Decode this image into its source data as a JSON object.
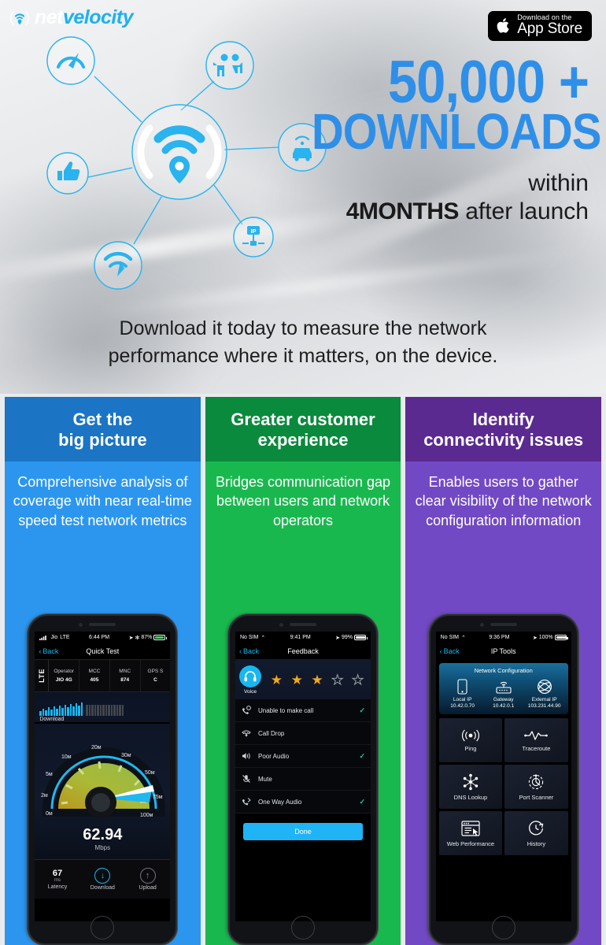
{
  "brand": {
    "name_part1": "net",
    "name_part2": "velocity",
    "accent": "#1eb0f0"
  },
  "appstore": {
    "small": "Download on the",
    "big": "App Store",
    "icon": "apple-icon"
  },
  "headline": {
    "count": "50,000 +",
    "word": "DOWNLOADS",
    "within": "within",
    "duration": "4MONTHS",
    "after": " after launch",
    "color": "#2f8fe8"
  },
  "diagram": {
    "center_icon": "netvelocity-wifi-locator-icon",
    "nodes": [
      {
        "icon": "speedometer-icon"
      },
      {
        "icon": "people-group-icon"
      },
      {
        "icon": "connected-car-icon"
      },
      {
        "icon": "ip-network-icon"
      },
      {
        "icon": "wifi-signal-icon"
      },
      {
        "icon": "thumbs-up-icon"
      }
    ]
  },
  "tagline": {
    "line1": "Download it today to measure the network",
    "line2": "performance where it matters, on the device."
  },
  "columns": [
    {
      "title_line1": "Get the",
      "title_line2": "big picture",
      "body": "Comprehensive analysis of coverage with near real-time speed test network metrics",
      "head_color": "#1b74c4",
      "body_color": "#2c96ef"
    },
    {
      "title_line1": "Greater customer",
      "title_line2": "experience",
      "body": "Bridges communication gap between users and network operators",
      "head_color": "#0a8a3c",
      "body_color": "#19b84f"
    },
    {
      "title_line1": "Identify",
      "title_line2": "connectivity issues",
      "body": "Enables users to gather clear visibility of the network configuration information",
      "head_color": "#5b2a91",
      "body_color": "#7249c4"
    }
  ],
  "phone1": {
    "status": {
      "carrier": "Jio",
      "network": "LTE",
      "time": "6:44 PM",
      "battery": "87%"
    },
    "nav": {
      "back": "Back",
      "title": "Quick Test"
    },
    "badge": "LTE",
    "table": {
      "headers": [
        "Operator",
        "MCC",
        "MNC",
        "GPS S"
      ],
      "values": [
        "JIO 4G",
        "405",
        "874",
        "C"
      ]
    },
    "graph_label": "Download",
    "gauge": {
      "ticks": [
        "0M",
        "2M",
        "5M",
        "10M",
        "20M",
        "30M",
        "50M",
        "75M",
        "100M"
      ],
      "value": "62.94",
      "unit": "Mbps",
      "needle_pct": 0.63
    },
    "stats": [
      {
        "value": "67",
        "unit": "ms",
        "label": "Latency"
      },
      {
        "icon": "download-arrow-icon",
        "label": "Download",
        "active": true
      },
      {
        "icon": "upload-arrow-icon",
        "label": "Upload",
        "active": false
      }
    ]
  },
  "phone2": {
    "status": {
      "carrier": "No SIM",
      "time": "9:41 PM",
      "battery": "99%"
    },
    "nav": {
      "back": "Back",
      "title": "Feedback"
    },
    "rating": {
      "icon": "headset-icon",
      "label": "Voice",
      "filled": 3,
      "total": 5,
      "star_color": "#f0a91c"
    },
    "items": [
      {
        "icon": "call-missed-icon",
        "label": "Unable to make call",
        "checked": true
      },
      {
        "icon": "call-drop-icon",
        "label": "Call Drop",
        "checked": false
      },
      {
        "icon": "poor-audio-icon",
        "label": "Poor Audio",
        "checked": true
      },
      {
        "icon": "mute-mic-icon",
        "label": "Mute",
        "checked": false
      },
      {
        "icon": "one-way-audio-icon",
        "label": "One Way Audio",
        "checked": true
      }
    ],
    "done_label": "Done"
  },
  "phone3": {
    "status": {
      "carrier": "No SIM",
      "time": "9:36 PM",
      "battery": "100%"
    },
    "nav": {
      "back": "Back",
      "title": "IP Tools"
    },
    "card": {
      "title": "Network Configuration",
      "entries": [
        {
          "icon": "mobile-device-icon",
          "label": "Local IP",
          "value": "10.42.0.70"
        },
        {
          "icon": "router-icon",
          "label": "Gateway",
          "value": "10.42.0.1"
        },
        {
          "icon": "globe-network-icon",
          "label": "External IP",
          "value": "103.231.44.90"
        }
      ]
    },
    "tools": [
      {
        "icon": "ping-signal-icon",
        "label": "Ping"
      },
      {
        "icon": "traceroute-pulse-icon",
        "label": "Traceroute"
      },
      {
        "icon": "dns-nodes-icon",
        "label": "DNS Lookup"
      },
      {
        "icon": "port-scanner-radar-icon",
        "label": "Port Scanner"
      },
      {
        "icon": "web-performance-icon",
        "label": "Web Performance"
      },
      {
        "icon": "history-clock-icon",
        "label": "History"
      }
    ]
  }
}
